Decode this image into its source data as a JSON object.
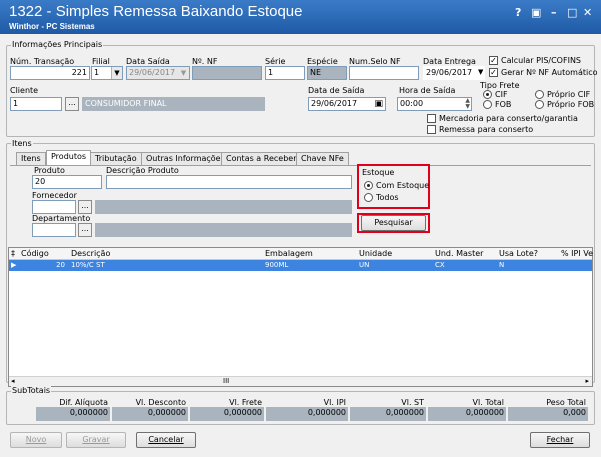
{
  "window": {
    "title": "1322 - Simples Remessa Baixando Estoque",
    "subtitle": "Winthor - PC Sistemas",
    "help_label": "?",
    "minimize_label": "–",
    "maximize_label": "□",
    "close_label": "✕"
  },
  "main_info": {
    "legend": "Informações Principais",
    "num_transacao_label": "Núm. Transação",
    "num_transacao_value": "221",
    "filial_label": "Filial",
    "filial_value": "1",
    "data_saida_label": "Data Saída",
    "data_saida_value": "29/06/2017",
    "nf_label": "Nº. NF",
    "nf_value": "",
    "serie_label": "Série",
    "serie_value": "1",
    "especie_label": "Espécie",
    "especie_value": "NE",
    "num_selo_label": "Num.Selo NF",
    "num_selo_value": "",
    "data_entrega_label": "Data Entrega",
    "data_entrega_value": "29/06/2017",
    "calc_pis_label": "Calcular PIS/COFINS",
    "gerar_nf_label": "Gerar Nº NF Automático",
    "cliente_label": "Cliente",
    "cliente_code": "1",
    "cliente_name": "CONSUMIDOR FINAL",
    "data_saida2_label": "Data de Saída",
    "data_saida2_value": "29/06/2017",
    "hora_saida_label": "Hora de Saída",
    "hora_saida_value": "00:00",
    "tipo_frete_label": "Tipo Frete",
    "frete_cif": "CIF",
    "frete_fob": "FOB",
    "frete_proprio_cif": "Próprio CIF",
    "frete_proprio_fob": "Próprio FOB",
    "merc_conserto_label": "Mercadoria para conserto/garantia",
    "remessa_conserto_label": "Remessa para conserto"
  },
  "items": {
    "legend": "Itens",
    "tabs": [
      "Itens",
      "Produtos",
      "Tributação",
      "Outras Informações",
      "Contas a Receber",
      "Chave NFe"
    ],
    "produto_label": "Produto",
    "produto_value": "20",
    "descricao_label": "Descrição Produto",
    "descricao_value": "",
    "fornecedor_label": "Fornecedor",
    "departamento_label": "Departamento",
    "estoque_label": "Estoque",
    "com_estoque_label": "Com Estoque",
    "todos_label": "Todos",
    "pesquisar_label": "Pesquisar",
    "ellipsis": "..."
  },
  "grid": {
    "columns": [
      "Código",
      "Descrição",
      "Embalagem",
      "Unidade",
      "Und. Master",
      "Usa Lote?",
      "% IPI Ve"
    ],
    "rows": [
      {
        "codigo": "20",
        "descricao": "10%/C ST",
        "embalagem": "900ML",
        "unidade": "UN",
        "und_master": "CX",
        "usa_lote": "N",
        "ipi": ""
      }
    ],
    "scroll_mark": "III"
  },
  "subtotals": {
    "legend": "SubTotais",
    "items": [
      {
        "label": "Dif. Alíquota",
        "value": "0,000000"
      },
      {
        "label": "Vl. Desconto",
        "value": "0,000000"
      },
      {
        "label": "Vl. Frete",
        "value": "0,000000"
      },
      {
        "label": "Vl. IPI",
        "value": "0,000000"
      },
      {
        "label": "Vl. ST",
        "value": "0,000000"
      },
      {
        "label": "Vl. Total",
        "value": "0,000000"
      },
      {
        "label": "Peso Total",
        "value": "0,000"
      }
    ]
  },
  "footer": {
    "novo_label": "Novo",
    "gravar_label": "Gravar",
    "cancelar_label": "Cancelar",
    "fechar_label": "Fechar"
  }
}
